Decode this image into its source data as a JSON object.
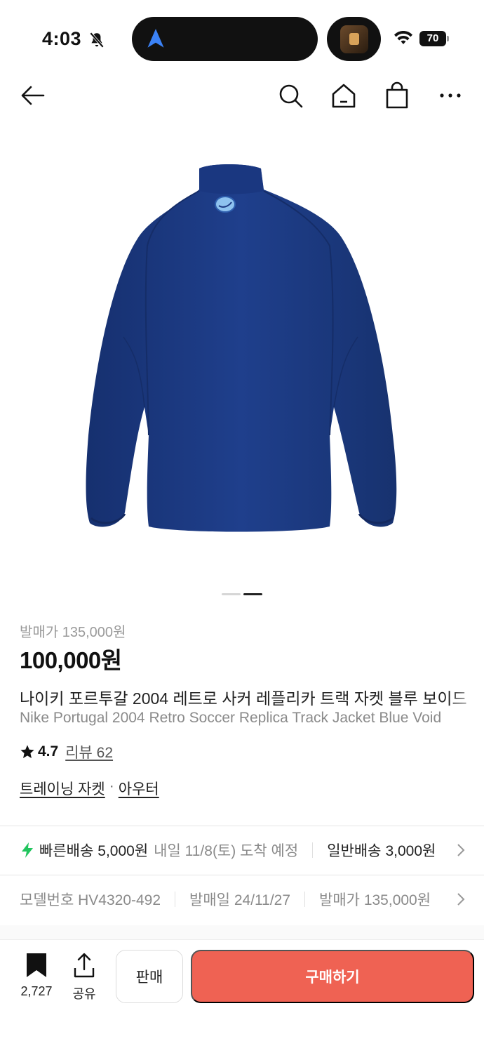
{
  "status_bar": {
    "time": "4:03",
    "battery": "70"
  },
  "nav": {
    "icons": [
      "back-arrow-icon",
      "search-icon",
      "home-icon",
      "shopping-bag-icon",
      "more-icon"
    ]
  },
  "carousel": {
    "total_slides": 2,
    "active_slide": 2
  },
  "product": {
    "release_price_line": "발매가 135,000원",
    "price": "100,000원",
    "title_ko": "나이키 포르투갈 2004 레트로 사커 레플리카 트랙 자켓 블루 보이드",
    "title_en": "Nike Portugal 2004 Retro Soccer Replica Track Jacket Blue Void",
    "rating": "4.7",
    "review_label": "리뷰 62",
    "category_1": "트레이닝 자켓",
    "category_sep": "·",
    "category_2": "아우터"
  },
  "shipping": {
    "fast_label": "빠른배송",
    "fast_price": "5,000원",
    "fast_eta": "내일 11/8(토) 도착 예정",
    "normal_label": "일반배송",
    "normal_price": "3,000원"
  },
  "specs": {
    "model": "모델번호 HV4320-492",
    "release_date": "발매일 24/11/27",
    "release_price": "발매가 135,000원"
  },
  "bottom_bar": {
    "bookmark_count": "2,727",
    "share_label": "공유",
    "sell_label": "판매",
    "buy_label": "구매하기"
  },
  "colors": {
    "buy_button": "#ef6253",
    "jacket": "#1d3a82",
    "bolt": "#22c55e"
  }
}
